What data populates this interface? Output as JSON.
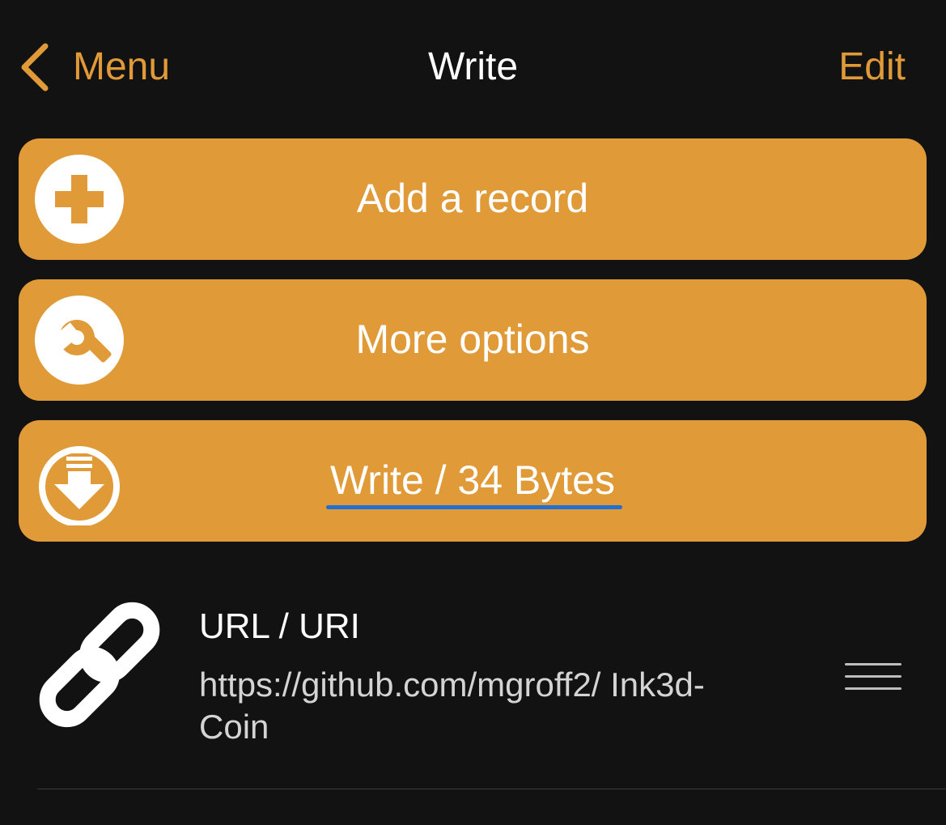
{
  "nav": {
    "back_label": "Menu",
    "title": "Write",
    "edit_label": "Edit"
  },
  "actions": {
    "add_record_label": "Add a record",
    "more_options_label": "More options",
    "write_label": "Write / 34 Bytes"
  },
  "record": {
    "type_label": "URL / URI",
    "value": "https://github.com/mgroff2/ Ink3d-Coin"
  },
  "icons": {
    "back": "chevron-left-icon",
    "add": "plus-circle-icon",
    "options": "wrench-icon",
    "write": "download-circle-icon",
    "record_type": "link-icon",
    "reorder": "drag-handle-icon"
  },
  "colors": {
    "background": "#121212",
    "accent": "#E09A38",
    "text": "#FFFFFF",
    "underline": "#1F6FD6"
  }
}
